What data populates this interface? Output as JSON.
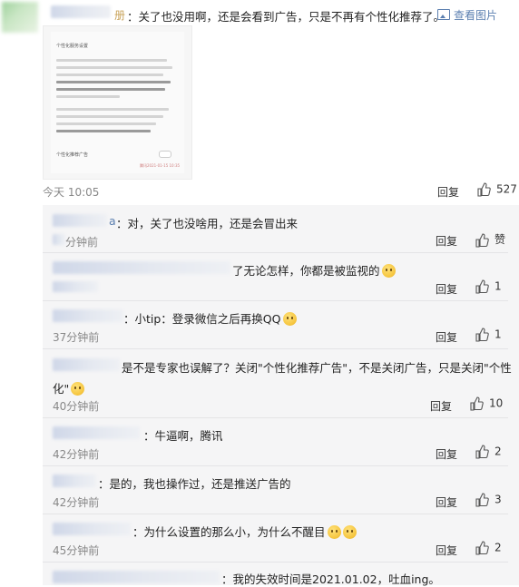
{
  "post": {
    "user_suffix": "册",
    "text": "：关了也没用啊，还是会看到广告，只是不再有个性化推荐了。",
    "view_image": "查看图片",
    "time": "今天 10:05",
    "reply": "回复",
    "likes": "527",
    "screenshot": {
      "title": "个性化服务设置",
      "toggle_label": "个性化推荐广告",
      "stamp": "腾讯2021-01-15 10:35"
    }
  },
  "replies": [
    {
      "user_suffix": "a",
      "text": "：对，关了也没啥用，还是会冒出来",
      "time": "分钟前",
      "reply": "回复",
      "likes": "赞",
      "emoji": false
    },
    {
      "user_suffix": "",
      "text": "了无论怎样，你都是被监视的",
      "time": "",
      "reply": "回复",
      "likes": "1",
      "emoji": true
    },
    {
      "user_suffix": "",
      "text": "：小tip：登录微信之后再换QQ",
      "time": "37分钟前",
      "reply": "回复",
      "likes": "1",
      "emoji": true
    },
    {
      "user_suffix": "",
      "text": "是不是专家也误解了？关闭\"个性化推荐广告\"，不是关闭广告，只是关闭\"个性",
      "text2": "化\"",
      "time": "40分钟前",
      "reply": "回复",
      "likes": "10",
      "emoji": true
    },
    {
      "user_suffix": "",
      "text": "：牛逼啊，腾讯",
      "time": "42分钟前",
      "reply": "回复",
      "likes": "2",
      "emoji": false
    },
    {
      "user_suffix": "",
      "text": "：是的，我也操作过，还是推送广告的",
      "time": "42分钟前",
      "reply": "回复",
      "likes": "3",
      "emoji": false
    },
    {
      "user_suffix": "",
      "text": "：为什么设置的那么小，为什么不醒目",
      "time": "45分钟前",
      "reply": "回复",
      "likes": "2",
      "emoji": true
    },
    {
      "user_suffix": "",
      "text": "：我的失效时间是2021.01.02，吐血ing。",
      "time": "",
      "reply": "",
      "likes": "",
      "emoji": false
    }
  ],
  "colors": {
    "link": "#5b7fb0",
    "reply_bg": "#f5f5f6",
    "divider": "#e4e4e6"
  }
}
